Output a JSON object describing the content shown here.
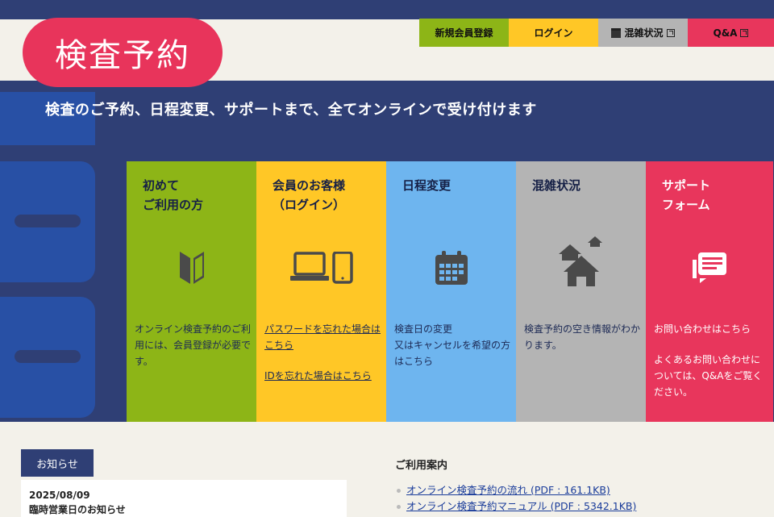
{
  "logo": {
    "text": "検査予約"
  },
  "top_nav": {
    "register": "新規会員登録",
    "login": "ログイン",
    "congestion": "混雑状況",
    "qa": "Q&A"
  },
  "hero": {
    "tagline": "検査のご予約、日程変更、サポートまで、全てオンラインで受け付けます"
  },
  "cards": [
    {
      "title": "初めて\nご利用の方",
      "icon": "beginner-mark-icon",
      "desc": "オンライン検査予約のご利用には、会員登録が必要です。"
    },
    {
      "title": "会員のお客様\n（ログイン）",
      "icon": "laptop-tablet-icon",
      "link1": "パスワードを忘れた場合はこちら",
      "link2": "IDを忘れた場合はこちら"
    },
    {
      "title": "日程変更",
      "icon": "calendar-icon",
      "desc": "検査日の変更\n又はキャンセルを希望の方はこちら"
    },
    {
      "title": "混雑状況",
      "icon": "houses-icon",
      "desc": "検査予約の空き情報がわかります。"
    },
    {
      "title": "サポート\nフォーム",
      "icon": "chat-icon",
      "desc1": "お問い合わせはこちら",
      "desc2": "よくあるお問い合わせについては、Q&Aをご覧ください。"
    }
  ],
  "news": {
    "tab": "お知らせ",
    "date": "2025/08/09",
    "title": "臨時営業日のお知らせ"
  },
  "guide": {
    "title": "ご利用案内",
    "items": [
      "オンライン検査予約の流れ (PDF : 161.1KB)",
      "オンライン検査予約マニュアル (PDF : 5342.1KB)"
    ]
  },
  "colors": {
    "navy": "#2f3f75",
    "green": "#8db517",
    "yellow": "#ffc726",
    "blue": "#6eb5ef",
    "gray": "#b4b4b4",
    "pink": "#e8365c"
  }
}
